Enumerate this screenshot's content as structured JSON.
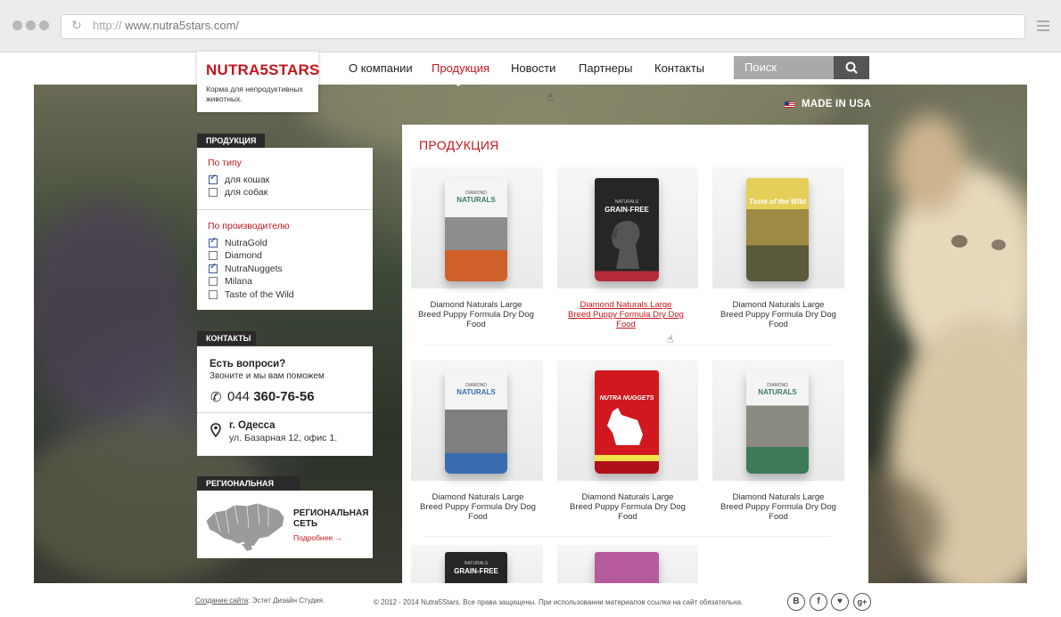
{
  "browser": {
    "url_proto": "http://",
    "url_host": "www.nutra5stars.com/"
  },
  "logo": {
    "title": "NUTRA5STARS",
    "subtitle": "Корма для непродуктивных животных."
  },
  "nav": {
    "items": [
      {
        "label": "О компании",
        "active": false
      },
      {
        "label": "Продукция",
        "active": true
      },
      {
        "label": "Новости",
        "active": false
      },
      {
        "label": "Партнеры",
        "active": false
      },
      {
        "label": "Контакты",
        "active": false
      }
    ],
    "search_placeholder": "Поиск"
  },
  "badge": {
    "made_in": "MADE IN USA"
  },
  "sidebar": {
    "products_tab": "ПРОДУКЦИЯ",
    "by_type": "По типу",
    "types": [
      {
        "label": "для кошак",
        "checked": true
      },
      {
        "label": "для собак",
        "checked": false
      }
    ],
    "by_maker": "По производителю",
    "makers": [
      {
        "label": "NutraGold",
        "checked": true
      },
      {
        "label": "Diamond",
        "checked": false
      },
      {
        "label": "NutraNuggets",
        "checked": true
      },
      {
        "label": "Milana",
        "checked": false
      },
      {
        "label": "Taste of the Wild",
        "checked": false
      }
    ],
    "contacts_tab": "КОНТАКТЫ",
    "question": "Есть вопроси?",
    "call_us": "Звоните и мы вам поможем",
    "phone_code": "044",
    "phone_num": "360-76-56",
    "city": "г. Одесса",
    "address": "ул. Базарная 12, офис 1.",
    "regional_tab": "РЕГИОНАЛЬНАЯ СЕТЬ",
    "regional_title_1": "РЕГИОНАЛЬНАЯ",
    "regional_title_2": "СЕТЬ",
    "regional_more": "Подробнее",
    "regional_more_arrow": "→"
  },
  "content": {
    "title": "ПРОДУКЦИЯ",
    "products": [
      {
        "caption": "Diamond Naturals Large Breed Puppy Formula Dry Dog Food",
        "bag_brand": "NATURALS",
        "bag_maker": "DIAMOND",
        "bag_color": "#d0602a"
      },
      {
        "caption": "Diamond Naturals Large Breed Puppy Formula Dry Dog Food",
        "bag_brand": "GRAIN-FREE",
        "bag_maker": "NATURALS",
        "bag_color": "#1e1e1e"
      },
      {
        "caption": "Diamond Naturals Large Breed Puppy Formula Dry Dog Food",
        "bag_brand": "Taste of the Wild",
        "bag_maker": "",
        "bag_color": "#c9a640"
      },
      {
        "caption": "Diamond Naturals Large Breed Puppy Formula Dry Dog Food",
        "bag_brand": "NATURALS",
        "bag_maker": "DIAMOND",
        "bag_color": "#3a6cb0"
      },
      {
        "caption": "Diamond Naturals Large Breed Puppy Formula Dry Dog Food",
        "bag_brand": "NUTRA NUGGETS",
        "bag_maker": "",
        "bag_color": "#c8101a"
      },
      {
        "caption": "Diamond Naturals Large Breed Puppy Formula Dry Dog Food",
        "bag_brand": "NATURALS",
        "bag_maker": "DIAMOND",
        "bag_color": "#3d7a5a"
      }
    ],
    "row3_bag1_brand": "GRAIN-FREE",
    "row3_bag1_maker": "NATURALS"
  },
  "footer": {
    "created_link": "Создание сайта",
    "created_by": ": Эстет Дизайн Студия.",
    "copyright": "© 2012 - 2014 Nutra5Stars. Все права защищены. При использовании материалов ссылка на сайт обязательна.",
    "social": [
      "В",
      "f",
      "♥",
      "g+"
    ]
  },
  "colors": {
    "brand_red": "#c4161c",
    "dark": "#2a2a2a",
    "search_bg": "#a9a9a9"
  }
}
